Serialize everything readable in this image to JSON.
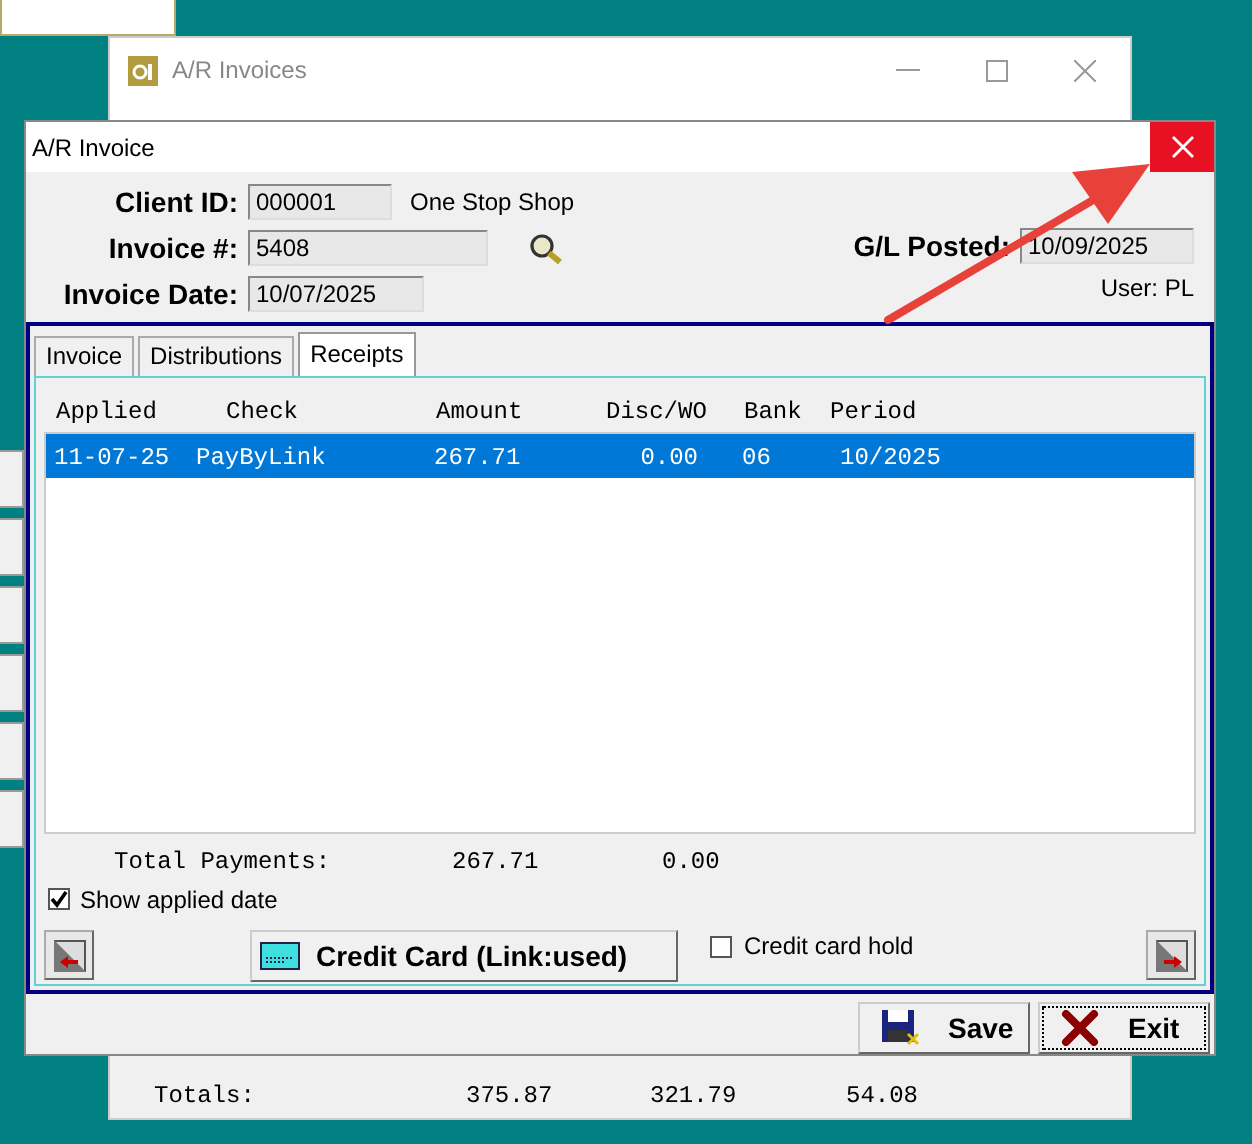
{
  "background_window": {
    "title": "A/R Invoices",
    "totals": {
      "label": "Totals:",
      "values": [
        "375.87",
        "321.79",
        "54.08"
      ]
    }
  },
  "dialog": {
    "title": "A/R Invoice",
    "fields": [
      {
        "label": "Client ID:",
        "value": "000001"
      },
      {
        "label": "Invoice #:",
        "value": "5408"
      },
      {
        "label": "Invoice Date:",
        "value": "10/07/2025"
      }
    ],
    "client_name": "One Stop Shop",
    "gl_posted": {
      "label": "G/L Posted:",
      "value": "10/09/2025"
    },
    "user": "User: PL"
  },
  "tabs": [
    {
      "label": "Invoice",
      "selected": false
    },
    {
      "label": "Distributions",
      "selected": false
    },
    {
      "label": "Receipts",
      "selected": true
    }
  ],
  "receipts": {
    "columns": [
      "Applied",
      "Check",
      "Amount",
      "Disc/WO",
      "Bank",
      "Period"
    ],
    "rows": [
      {
        "cells": [
          "11-07-25",
          "PayByLink",
          "267.71",
          "0.00",
          "06",
          "10/2025"
        ],
        "selected": true
      }
    ]
  },
  "total_payments": {
    "label": "Total Payments:",
    "amount": "267.71",
    "disc": "0.00"
  },
  "show_applied_date": {
    "label": "Show applied date",
    "checked": true
  },
  "credit_card_button": "Credit Card (Link:used)",
  "credit_card_hold": {
    "label": "Credit card hold",
    "checked": false
  },
  "buttons": [
    {
      "kind": "save",
      "label": "Save"
    },
    {
      "kind": "exit",
      "label": "Exit"
    }
  ]
}
